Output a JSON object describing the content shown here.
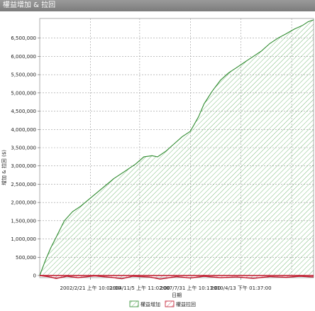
{
  "window": {
    "title": "權益增加 & 拉回"
  },
  "chart_data": {
    "type": "area",
    "xlabel": "日期",
    "ylabel": "增加 & 拉回 ($)",
    "ylim": [
      0,
      7000000
    ],
    "grid": true,
    "legend_position": "bottom",
    "y_ticks": [
      {
        "value": 0,
        "label": "0"
      },
      {
        "value": 500000,
        "label": "500,000"
      },
      {
        "value": 1000000,
        "label": "1,000,000"
      },
      {
        "value": 1500000,
        "label": "1,500,000"
      },
      {
        "value": 2000000,
        "label": "2,000,000"
      },
      {
        "value": 2500000,
        "label": "2,500,000"
      },
      {
        "value": 3000000,
        "label": "3,000,000"
      },
      {
        "value": 3500000,
        "label": "3,500,000"
      },
      {
        "value": 4000000,
        "label": "4,000,000"
      },
      {
        "value": 4500000,
        "label": "4,500,000"
      },
      {
        "value": 5000000,
        "label": "5,000,000"
      },
      {
        "value": 5500000,
        "label": "5,500,000"
      },
      {
        "value": 6000000,
        "label": "6,000,000"
      },
      {
        "value": 6500000,
        "label": "6,500,000"
      }
    ],
    "x_ticks": [
      {
        "frac": 0.185,
        "label": "2002/2/21 上午 10:01:00"
      },
      {
        "frac": 0.365,
        "label": "2004/11/5 上午 11:02:00"
      },
      {
        "frac": 0.55,
        "label": "2007/7/31 上午 10:13:00"
      },
      {
        "frac": 0.735,
        "label": "2010/4/13 下午 01:37:00"
      }
    ],
    "x_grid": [
      0.185,
      0.365,
      0.55,
      0.735,
      0.92
    ],
    "series": [
      {
        "name": "權益增加",
        "color": "#2e8b2e",
        "x": [
          0,
          0.02,
          0.04,
          0.06,
          0.09,
          0.12,
          0.15,
          0.19,
          0.23,
          0.27,
          0.31,
          0.35,
          0.38,
          0.41,
          0.43,
          0.46,
          0.49,
          0.52,
          0.55,
          0.58,
          0.6,
          0.63,
          0.66,
          0.69,
          0.72,
          0.75,
          0.78,
          0.81,
          0.84,
          0.87,
          0.9,
          0.93,
          0.96,
          0.98,
          1.0
        ],
        "values": [
          0,
          400000,
          750000,
          1050000,
          1500000,
          1750000,
          1900000,
          2150000,
          2400000,
          2650000,
          2850000,
          3050000,
          3250000,
          3280000,
          3250000,
          3400000,
          3600000,
          3800000,
          3950000,
          4350000,
          4700000,
          5050000,
          5350000,
          5550000,
          5700000,
          5850000,
          6000000,
          6150000,
          6350000,
          6500000,
          6620000,
          6750000,
          6850000,
          6950000,
          7000000
        ]
      },
      {
        "name": "權益拉回",
        "color": "#c0182c",
        "x": [
          0,
          0.03,
          0.06,
          0.1,
          0.14,
          0.2,
          0.26,
          0.3,
          0.34,
          0.4,
          0.44,
          0.5,
          0.55,
          0.6,
          0.66,
          0.72,
          0.78,
          0.84,
          0.9,
          0.95,
          1.0
        ],
        "values": [
          0,
          -30000,
          -80000,
          -20000,
          -60000,
          -10000,
          -50000,
          -90000,
          -20000,
          -40000,
          -100000,
          -30000,
          -70000,
          -20000,
          -60000,
          -40000,
          -80000,
          -30000,
          -50000,
          -20000,
          -40000
        ]
      }
    ]
  }
}
